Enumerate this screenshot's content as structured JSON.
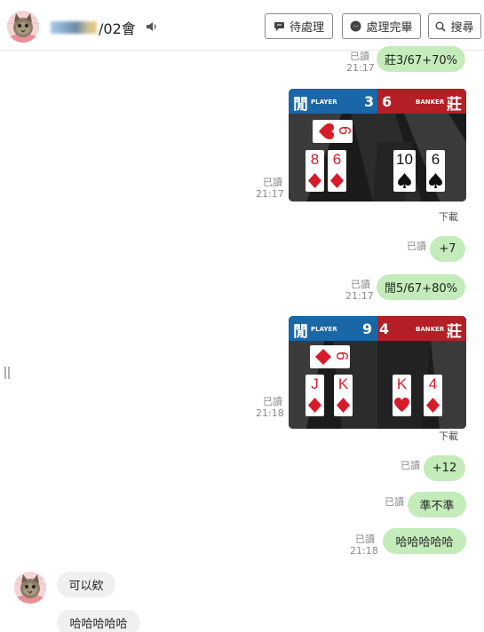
{
  "header": {
    "title_suffix": "/02會",
    "buttons": {
      "pending": "待處理",
      "done": "處理完畢",
      "search": "搜尋"
    }
  },
  "messages": [
    {
      "id": "m1",
      "read": "已讀",
      "time": "21:17",
      "text": "莊3/67+70%"
    },
    {
      "id": "img1",
      "read": "已讀",
      "time": "21:17",
      "download": "下載",
      "player_label": "PLAYER",
      "banker_label": "BANKER",
      "player_kanji": "閒",
      "banker_kanji": "莊",
      "player_score": "3",
      "banker_score": "6",
      "side_card": "6",
      "player_cards": [
        "8",
        "6"
      ],
      "banker_cards": [
        "10",
        "6"
      ]
    },
    {
      "id": "m2",
      "read": "已讀",
      "text": "+7"
    },
    {
      "id": "m3",
      "read": "已讀",
      "time": "21:17",
      "text": "閒5/67+80%"
    },
    {
      "id": "img2",
      "read": "已讀",
      "time": "21:18",
      "download": "下載",
      "player_label": "PLAYER",
      "banker_label": "BANKER",
      "player_kanji": "閒",
      "banker_kanji": "莊",
      "player_score": "9",
      "banker_score": "4",
      "side_card": "6",
      "player_cards": [
        "J",
        "K"
      ],
      "banker_cards": [
        "K",
        "4"
      ]
    },
    {
      "id": "m4",
      "read": "已讀",
      "text": "+12"
    },
    {
      "id": "m5",
      "read": "已讀",
      "text": "準不準"
    },
    {
      "id": "m6",
      "read": "已讀",
      "time": "21:18",
      "text": "哈哈哈哈哈"
    },
    {
      "id": "in1",
      "text": "可以欸"
    },
    {
      "id": "in2",
      "text": "哈哈哈哈哈"
    }
  ],
  "colors": {
    "outgoing_bubble": "#c4ecba",
    "incoming_bubble": "#f0f0f0",
    "player_blue": "#1a67a8",
    "banker_red": "#b31f25",
    "card_red": "#d81b2a"
  },
  "icons": {
    "pending": "speech-bubble-icon",
    "done": "messenger-icon",
    "search": "magnifier-icon",
    "speaker": "speaker-icon"
  }
}
